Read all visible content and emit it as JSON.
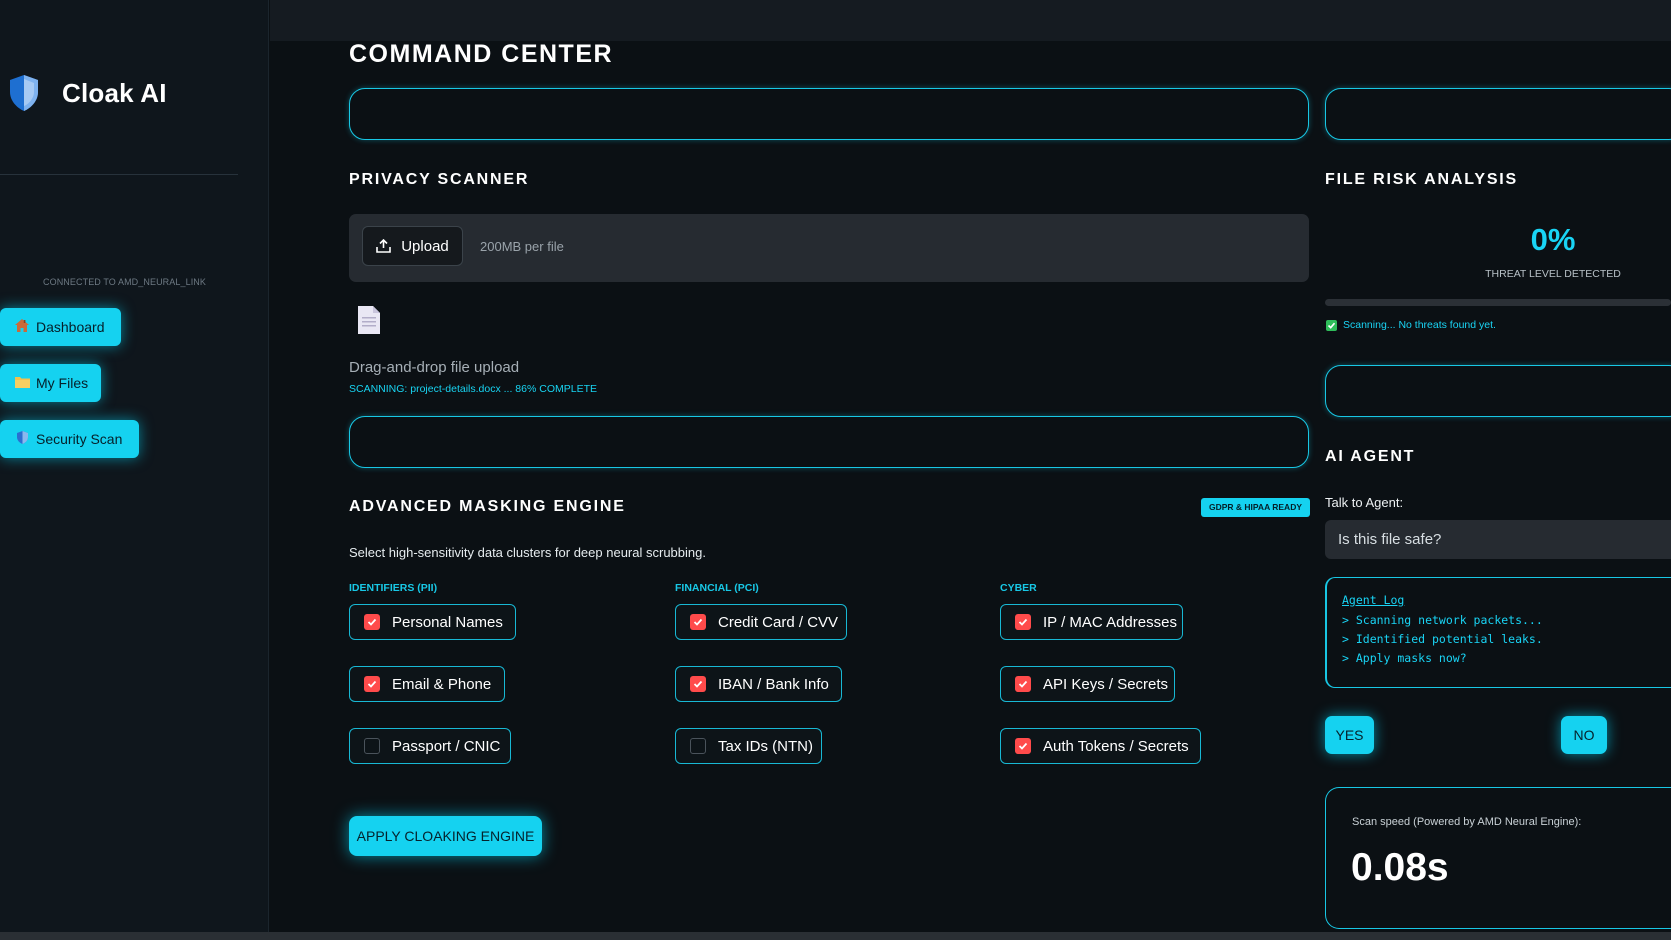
{
  "app": {
    "name": "Cloak AI",
    "connection_status": "CONNECTED TO AMD_NEURAL_LINK"
  },
  "nav": [
    {
      "label": "Dashboard",
      "icon": "house-icon"
    },
    {
      "label": "My Files",
      "icon": "folder-icon"
    },
    {
      "label": "Security Scan",
      "icon": "shield-icon"
    }
  ],
  "main": {
    "title": "COMMAND CENTER"
  },
  "scanner": {
    "title": "PRIVACY SCANNER",
    "upload_label": "Upload",
    "size_limit": "200MB per file",
    "dropzone_label": "Drag-and-drop file upload",
    "status": "SCANNING: project-details.docx ... 86% COMPLETE"
  },
  "masking": {
    "title": "ADVANCED MASKING ENGINE",
    "badge": "GDPR & HIPAA READY",
    "description": "Select high-sensitivity data clusters for deep neural scrubbing.",
    "columns": [
      {
        "heading": "IDENTIFIERS (PII)",
        "options": [
          {
            "label": "Personal Names",
            "checked": true
          },
          {
            "label": "Email & Phone",
            "checked": true
          },
          {
            "label": "Passport / CNIC",
            "checked": false
          }
        ]
      },
      {
        "heading": "FINANCIAL (PCI)",
        "options": [
          {
            "label": "Credit Card / CVV",
            "checked": true
          },
          {
            "label": "IBAN / Bank Info",
            "checked": true
          },
          {
            "label": "Tax IDs (NTN)",
            "checked": false
          }
        ]
      },
      {
        "heading": "CYBER",
        "options": [
          {
            "label": "IP / MAC Addresses",
            "checked": true
          },
          {
            "label": "API Keys / Secrets",
            "checked": true
          },
          {
            "label": "Auth Tokens / Secrets",
            "checked": true
          }
        ]
      }
    ],
    "apply_label": "APPLY CLOAKING ENGINE"
  },
  "risk": {
    "title": "FILE RISK ANALYSIS",
    "percent_text": "0%",
    "percent_value": 0,
    "label": "THREAT LEVEL DETECTED",
    "status": "Scanning... No threats found yet."
  },
  "agent": {
    "title": "AI AGENT",
    "talk_label": "Talk to Agent:",
    "input_value": "Is this file safe?",
    "log_title": "Agent Log",
    "log_lines": [
      "> Scanning network packets...",
      "> Identified potential leaks.",
      "> Apply masks now?"
    ],
    "yes_label": "YES",
    "no_label": "NO"
  },
  "speed": {
    "label": "Scan speed (Powered by AMD Neural Engine):",
    "value": "0.08s"
  },
  "colors": {
    "accent": "#15d2f0",
    "check": "#ff4b4b",
    "background": "#0b1014",
    "sidebar": "#0f161c"
  }
}
